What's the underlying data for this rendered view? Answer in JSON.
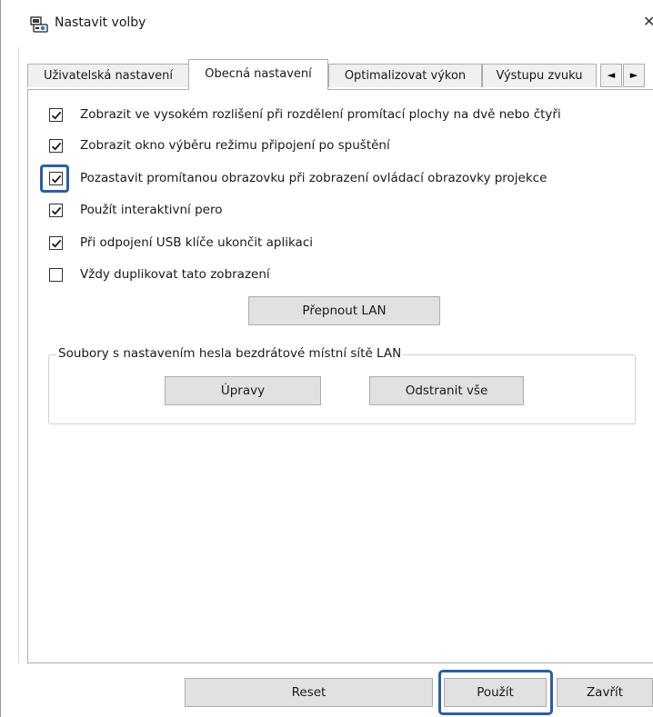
{
  "window": {
    "title": "Nastavit volby",
    "close_glyph": "✕",
    "icon": "projector-icon"
  },
  "tabs": [
    {
      "label": "Uživatelská nastavení",
      "active": false
    },
    {
      "label": "Obecná nastavení",
      "active": true
    },
    {
      "label": "Optimalizovat výkon",
      "active": false
    },
    {
      "label": "Výstupu zvuku",
      "active": false
    }
  ],
  "tab_scroll": {
    "left": "◄",
    "right": "►"
  },
  "options": [
    {
      "label": "Zobrazit ve vysokém rozlišení při rozdělení promítací plochy na dvě nebo čtyři",
      "checked": true
    },
    {
      "label": "Zobrazit okno výběru režimu připojení po spuštění",
      "checked": true
    },
    {
      "label": "Pozastavit promítanou obrazovku při zobrazení ovládací obrazovky projekce",
      "checked": true,
      "highlighted": true
    },
    {
      "label": "Použít interaktivní pero",
      "checked": true
    },
    {
      "label": "Při odpojení USB klíče ukončit aplikaci",
      "checked": true
    },
    {
      "label": "Vždy duplikovat tato zobrazení",
      "checked": false
    }
  ],
  "switch_lan_button": "Přepnout LAN",
  "wlan_group": {
    "title": "Soubory s nastavením hesla bezdrátové místní sítě LAN",
    "edit_button": "Úpravy",
    "delete_all_button": "Odstranit vše"
  },
  "footer": {
    "reset": "Reset",
    "apply": "Použít",
    "close": "Zavřít"
  },
  "colors": {
    "highlight": "#2b5fa3",
    "button_bg": "#e1e1e1",
    "tab_bg": "#f0f0f0"
  }
}
